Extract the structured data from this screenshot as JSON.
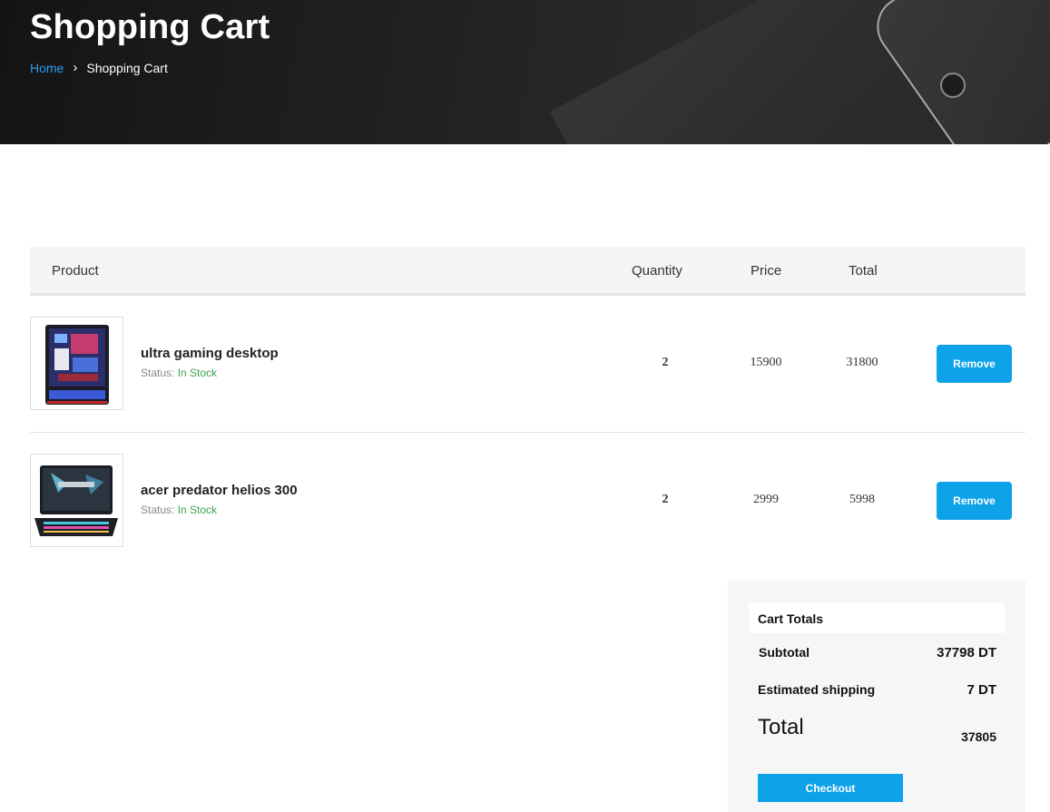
{
  "header": {
    "title": "Shopping Cart",
    "breadcrumb": {
      "home": "Home",
      "separator": "›",
      "current": "Shopping Cart"
    }
  },
  "table": {
    "columns": {
      "product": "Product",
      "quantity": "Quantity",
      "price": "Price",
      "total": "Total"
    },
    "status_label": "Status:",
    "remove_label": "Remove",
    "rows": [
      {
        "name": "ultra gaming desktop",
        "status": "In Stock",
        "quantity": "2",
        "price": "15900",
        "total": "31800",
        "image": "gaming-desktop-image"
      },
      {
        "name": "acer predator helios 300",
        "status": "In Stock",
        "quantity": "2",
        "price": "2999",
        "total": "5998",
        "image": "laptop-image"
      }
    ]
  },
  "totals": {
    "title": "Cart Totals",
    "subtotal_label": "Subtotal",
    "subtotal_value": "37798 DT",
    "shipping_label": "Estimated shipping",
    "shipping_value": "7 DT",
    "total_label": "Total",
    "total_value": "37805",
    "checkout_label": "Checkout"
  },
  "colors": {
    "accent": "#0ea2e8",
    "link": "#2d9cf0",
    "in_stock": "#3fa34d"
  }
}
